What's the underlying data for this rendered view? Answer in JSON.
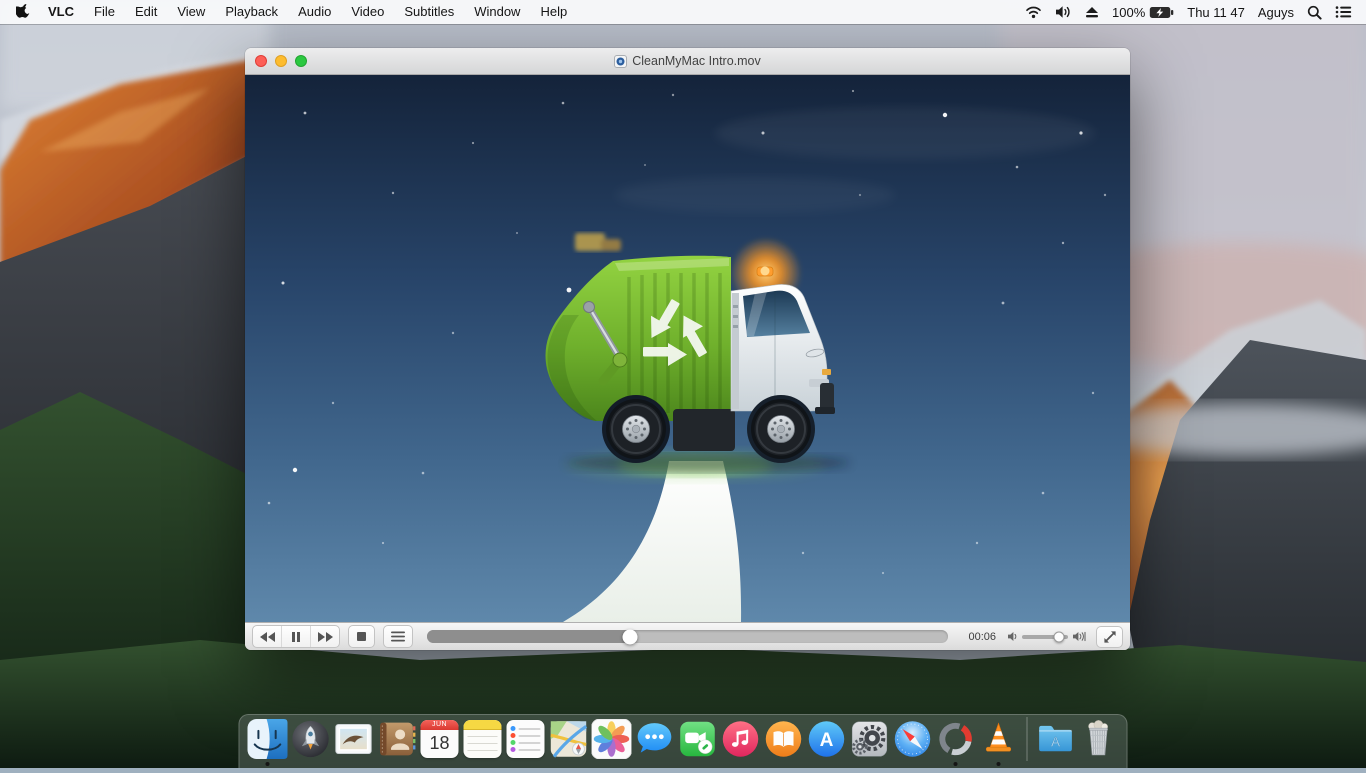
{
  "menu_bar": {
    "items": [
      "VLC",
      "File",
      "Edit",
      "View",
      "Playback",
      "Audio",
      "Video",
      "Subtitles",
      "Window",
      "Help"
    ],
    "status": {
      "battery": "100%",
      "clock": "Thu 11 47",
      "user": "Aguys",
      "icons": [
        "wifi-icon",
        "volume-icon",
        "eject-icon",
        "battery-icon",
        "spotlight-icon",
        "notification-center-icon"
      ]
    }
  },
  "window": {
    "title": "CleanMyMac Intro.mov",
    "traffic_lights": [
      "close",
      "minimize",
      "zoom"
    ],
    "controls": {
      "buttons": [
        "rewind",
        "pause",
        "fast-forward",
        "stop",
        "playlist",
        "fullscreen"
      ],
      "time": "00:06",
      "progress_percent": 39,
      "volume_percent": 80
    }
  },
  "video": {
    "description": "Animated green recycling garbage truck with orange beacon driving on a white road against a starry blue night sky"
  },
  "dock": {
    "items": [
      "Finder",
      "Launchpad",
      "Mail",
      "Contacts",
      "Calendar",
      "Notes",
      "Reminders",
      "Maps",
      "Photos",
      "Messages",
      "FaceTime",
      "iTunes",
      "iBooks",
      "App Store",
      "System Preferences",
      "Safari",
      "CleanMyMac",
      "VLC",
      "Applications",
      "Trash"
    ],
    "running": [
      "Finder",
      "CleanMyMac",
      "VLC"
    ],
    "calendar": {
      "month": "JUN",
      "day": "18"
    },
    "appstore_letter": "A",
    "folder_letter": "A"
  },
  "colors": {
    "menubar_bg": "#f7f8fa",
    "traffic_red": "#fd5f57",
    "traffic_yellow": "#fdbc2f",
    "traffic_green": "#2bc840",
    "video_sky_top": "#14233a",
    "video_sky_bottom": "#5f88ab",
    "truck_green": "#6fb02c",
    "beacon_orange": "#ff9d2e"
  }
}
